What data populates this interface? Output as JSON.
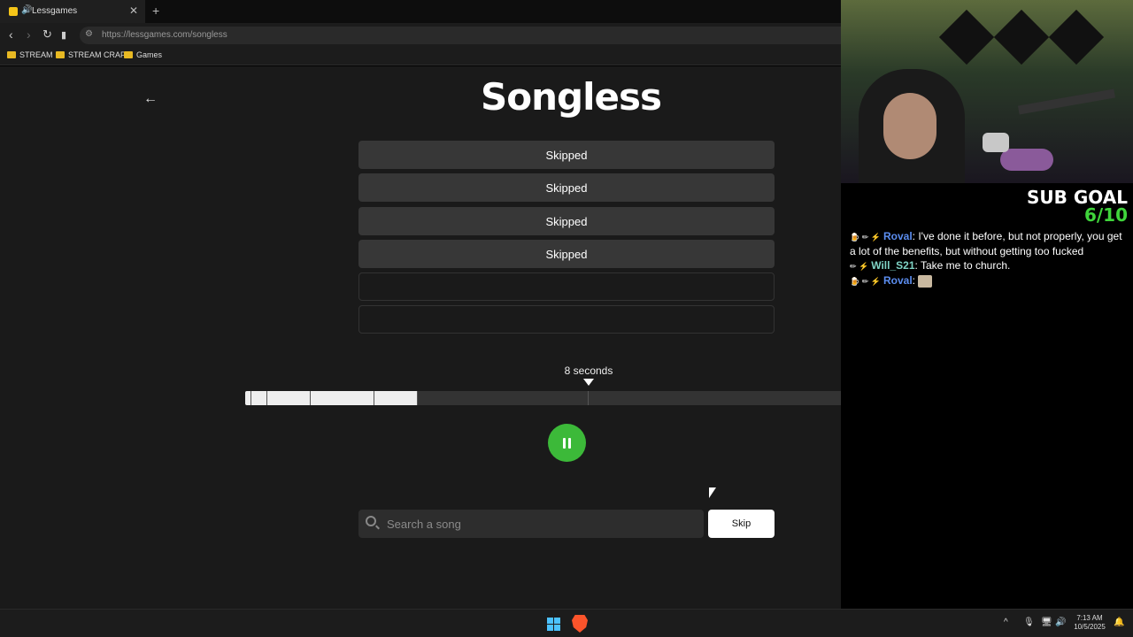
{
  "browser": {
    "tab_title": "Lessgames",
    "tab_audio_icon": "speaker-icon",
    "new_tab": "+",
    "close_tab": "✕",
    "url": "https://lessgames.com/songless",
    "bookmarks": [
      "STREAM",
      "STREAM CRAP",
      "Games"
    ]
  },
  "page": {
    "logo": "Songless",
    "guesses": [
      "Skipped",
      "Skipped",
      "Skipped",
      "Skipped",
      "",
      ""
    ],
    "seconds_label": "8 seconds",
    "progress": {
      "filled_seconds": 8,
      "total_seconds": 30,
      "played_seconds": 8
    },
    "search": {
      "placeholder": "Search a song",
      "value": ""
    },
    "skip_label": "Skip",
    "play_state": "playing"
  },
  "stream": {
    "sub_goal_title": "SUB GOAL",
    "sub_goal_count": "6/10",
    "chat": [
      {
        "user": "Roval",
        "text": ": I've done it before, but not properly, you get a lot of the benefits, but without getting too fucked",
        "color": "#5b8def"
      },
      {
        "user": "Will_S21",
        "text": ": Take me to church.",
        "color": "#7fd3c5"
      },
      {
        "user": "Roval",
        "text": ":",
        "color": "#5b8def",
        "emote": true
      }
    ]
  },
  "taskbar": {
    "time": "7:13 AM",
    "date": "10/5/2025"
  },
  "colors": {
    "accent_green": "#3cb939",
    "sub_goal_green": "#3fd43b",
    "page_bg": "#1a1a1a"
  }
}
